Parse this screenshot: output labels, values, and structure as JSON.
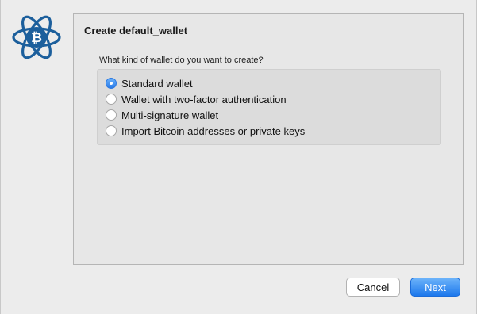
{
  "window": {
    "logo_icon": "electrum-bitcoin-logo-icon"
  },
  "panel": {
    "title": "Create default_wallet",
    "question": "What kind of wallet do you want to create?",
    "options": [
      {
        "label": "Standard wallet",
        "checked": true
      },
      {
        "label": "Wallet with two-factor authentication",
        "checked": false
      },
      {
        "label": "Multi-signature wallet",
        "checked": false
      },
      {
        "label": "Import Bitcoin addresses or private keys",
        "checked": false
      }
    ]
  },
  "buttons": {
    "cancel_label": "Cancel",
    "next_label": "Next"
  },
  "colors": {
    "accent": "#2a7be8",
    "logo": "#1c5f9c"
  }
}
